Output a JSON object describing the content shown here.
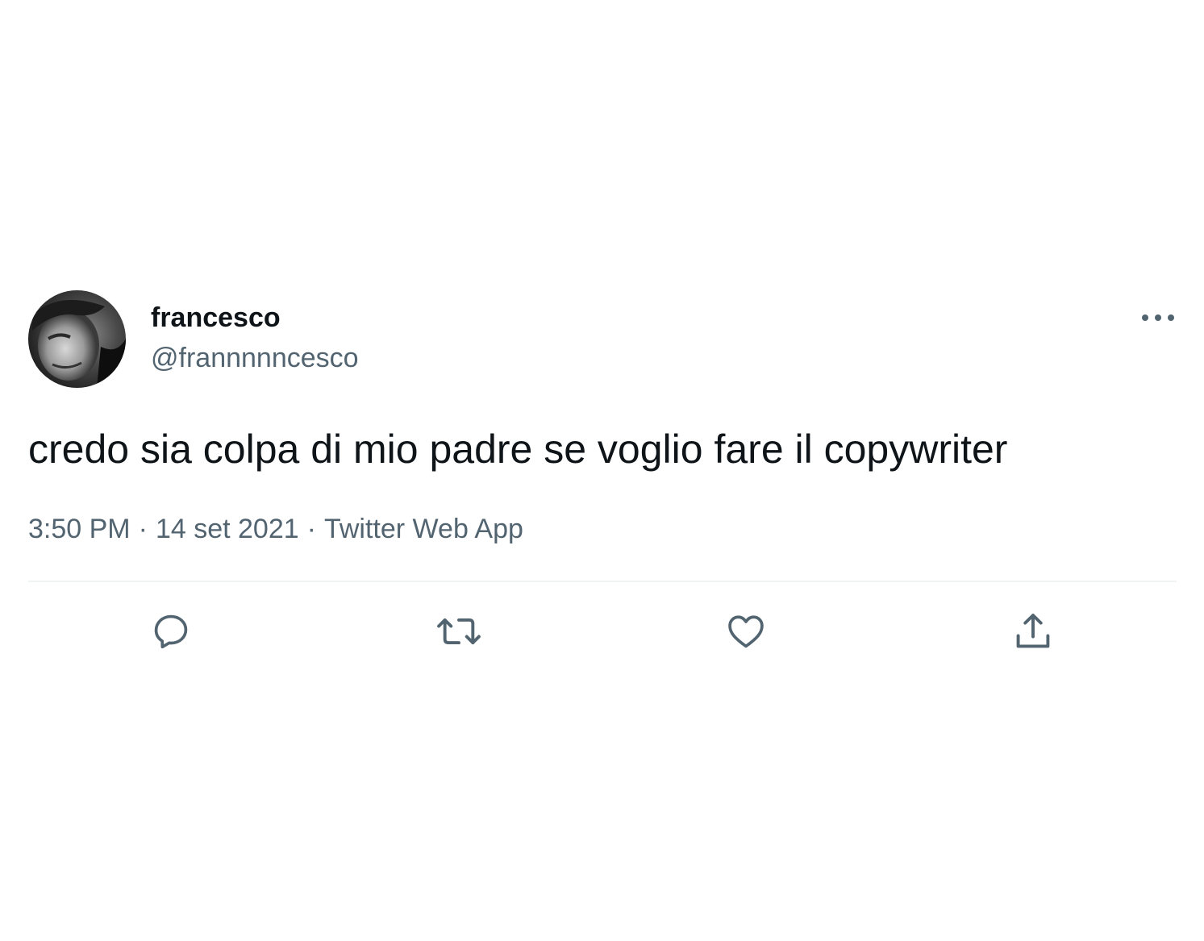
{
  "author": {
    "display_name": "francesco",
    "handle": "@frannnnncesco"
  },
  "tweet": {
    "text": "credo sia colpa di mio padre se voglio fare il copywriter"
  },
  "meta": {
    "time": "3:50 PM",
    "date": "14 set 2021",
    "source": "Twitter Web App",
    "separator": "·"
  },
  "actions": [
    {
      "name": "reply",
      "icon": "reply-icon"
    },
    {
      "name": "retweet",
      "icon": "retweet-icon"
    },
    {
      "name": "like",
      "icon": "heart-icon"
    },
    {
      "name": "share",
      "icon": "share-icon"
    }
  ],
  "colors": {
    "text_primary": "#0f1419",
    "text_secondary": "#536471",
    "divider": "#eff3f4"
  }
}
